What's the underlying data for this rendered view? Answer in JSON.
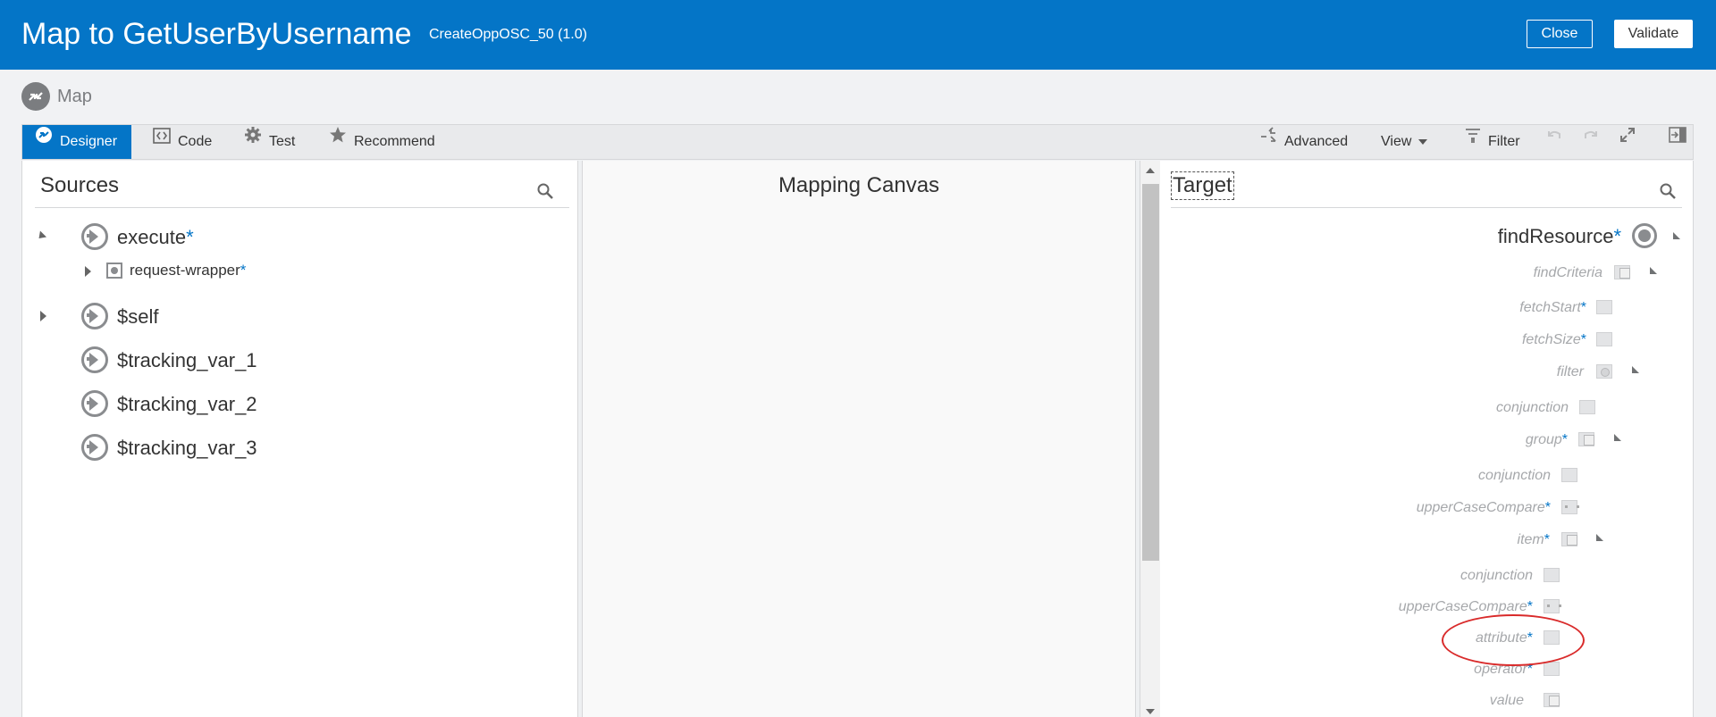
{
  "header": {
    "title": "Map to GetUserByUsername",
    "subtitle": "CreateOppOSC_50 (1.0)",
    "close_label": "Close",
    "validate_label": "Validate",
    "accent": "#0475c7"
  },
  "breadcrumb": {
    "label": "Map",
    "icon": "map-icon"
  },
  "toolbar": {
    "tabs": [
      {
        "label": "Designer",
        "icon": "designer-icon",
        "active": true
      },
      {
        "label": "Code",
        "icon": "code-icon"
      },
      {
        "label": "Test",
        "icon": "gear-icon"
      },
      {
        "label": "Recommend",
        "icon": "star-icon"
      }
    ],
    "advanced_label": "Advanced",
    "view_label": "View",
    "filter_label": "Filter"
  },
  "sources": {
    "title": "Sources",
    "items": [
      {
        "label": "execute",
        "required": "*"
      },
      {
        "label": "request-wrapper",
        "required": "*"
      },
      {
        "label": "$self"
      },
      {
        "label": "$tracking_var_1"
      },
      {
        "label": "$tracking_var_2"
      },
      {
        "label": "$tracking_var_3"
      }
    ]
  },
  "canvas": {
    "title": "Mapping Canvas"
  },
  "target": {
    "title": "Target",
    "items": [
      {
        "label": "findResource",
        "required": "*"
      },
      {
        "label": "findCriteria"
      },
      {
        "label": "fetchStart",
        "required": "*"
      },
      {
        "label": "fetchSize",
        "required": "*"
      },
      {
        "label": "filter"
      },
      {
        "label": "conjunction"
      },
      {
        "label": "group",
        "required": "*"
      },
      {
        "label": "conjunction"
      },
      {
        "label": "upperCaseCompare",
        "required": "*"
      },
      {
        "label": "item",
        "required": "*"
      },
      {
        "label": "conjunction"
      },
      {
        "label": "upperCaseCompare",
        "required": "*"
      },
      {
        "label": "attribute",
        "required": "*"
      },
      {
        "label": "operator",
        "required": "*"
      },
      {
        "label": "value"
      }
    ]
  },
  "annotation_color": "#d92b2b"
}
